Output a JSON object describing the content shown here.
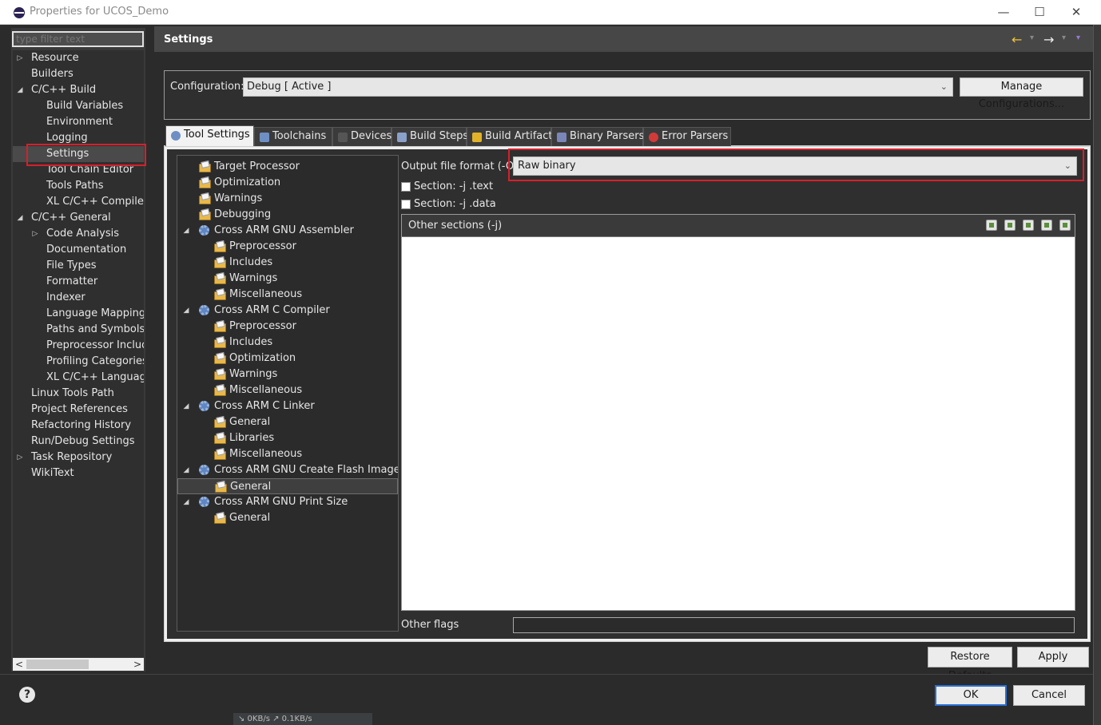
{
  "window": {
    "title": "Properties for UCOS_Demo",
    "controls": [
      "—",
      "☐",
      "✕"
    ]
  },
  "filter": {
    "placeholder": "type filter text"
  },
  "nav": {
    "items": [
      {
        "label": "Resource",
        "expander": "right"
      },
      {
        "label": "Builders"
      },
      {
        "label": "C/C++ Build",
        "expander": "down"
      },
      {
        "label": "Build Variables"
      },
      {
        "label": "Environment"
      },
      {
        "label": "Logging"
      },
      {
        "label": "Settings",
        "selected": true
      },
      {
        "label": "Tool Chain Editor"
      },
      {
        "label": "Tools Paths"
      },
      {
        "label": "XL C/C++ Compiler"
      },
      {
        "label": "C/C++ General",
        "expander": "down"
      },
      {
        "label": "Code Analysis",
        "expander": "right"
      },
      {
        "label": "Documentation"
      },
      {
        "label": "File Types"
      },
      {
        "label": "Formatter"
      },
      {
        "label": "Indexer"
      },
      {
        "label": "Language Mappings"
      },
      {
        "label": "Paths and Symbols"
      },
      {
        "label": "Preprocessor Include"
      },
      {
        "label": "Profiling Categories"
      },
      {
        "label": "XL C/C++ Language"
      },
      {
        "label": "Linux Tools Path"
      },
      {
        "label": "Project References"
      },
      {
        "label": "Refactoring History"
      },
      {
        "label": "Run/Debug Settings"
      },
      {
        "label": "Task Repository",
        "expander": "right"
      },
      {
        "label": "WikiText"
      }
    ],
    "scroll_left": "<",
    "scroll_right": ">"
  },
  "header": {
    "title": "Settings",
    "back_icon": "←",
    "forward_icon": "→",
    "menu_icon": "▾"
  },
  "config": {
    "label": "Configuration:",
    "value": "Debug  [ Active ]",
    "manage_label": "Manage Configurations..."
  },
  "tabs": [
    {
      "label": "Tool Settings",
      "icon": "gear-icon",
      "active": true
    },
    {
      "label": "Toolchains",
      "icon": "toolchain-icon"
    },
    {
      "label": "Devices",
      "icon": "chip-icon"
    },
    {
      "label": "Build Steps",
      "icon": "hammer-icon"
    },
    {
      "label": "Build Artifact",
      "icon": "trophy-icon"
    },
    {
      "label": "Binary Parsers",
      "icon": "binary-icon"
    },
    {
      "label": "Error Parsers",
      "icon": "error-icon"
    }
  ],
  "tooltree": {
    "items": [
      {
        "label": "Target Processor",
        "type": "folder"
      },
      {
        "label": "Optimization",
        "type": "folder"
      },
      {
        "label": "Warnings",
        "type": "folder"
      },
      {
        "label": "Debugging",
        "type": "folder"
      },
      {
        "label": "Cross ARM GNU Assembler",
        "type": "tool"
      },
      {
        "label": "Preprocessor",
        "type": "folder"
      },
      {
        "label": "Includes",
        "type": "folder"
      },
      {
        "label": "Warnings",
        "type": "folder"
      },
      {
        "label": "Miscellaneous",
        "type": "folder"
      },
      {
        "label": "Cross ARM C Compiler",
        "type": "tool"
      },
      {
        "label": "Preprocessor",
        "type": "folder"
      },
      {
        "label": "Includes",
        "type": "folder"
      },
      {
        "label": "Optimization",
        "type": "folder"
      },
      {
        "label": "Warnings",
        "type": "folder"
      },
      {
        "label": "Miscellaneous",
        "type": "folder"
      },
      {
        "label": "Cross ARM C Linker",
        "type": "tool"
      },
      {
        "label": "General",
        "type": "folder"
      },
      {
        "label": "Libraries",
        "type": "folder"
      },
      {
        "label": "Miscellaneous",
        "type": "folder"
      },
      {
        "label": "Cross ARM GNU Create Flash Image",
        "type": "tool"
      },
      {
        "label": "General",
        "type": "folder",
        "selected": true
      },
      {
        "label": "Cross ARM GNU Print Size",
        "type": "tool"
      },
      {
        "label": "General",
        "type": "folder"
      }
    ]
  },
  "options": {
    "format_label": "Output file format (-O)",
    "format_value": "Raw binary",
    "section_text": "Section: -j .text",
    "section_data": "Section: -j .data",
    "other_sections": "Other sections (-j)",
    "other_flags": "Other flags"
  },
  "buttons": {
    "restore": "Restore Defaults",
    "apply": "Apply",
    "ok": "OK",
    "cancel": "Cancel",
    "help": "?"
  },
  "taskbar": {
    "net": "↘ 0KB/s    ↗ 0.1KB/s"
  },
  "colors": {
    "highlight": "#d6202b",
    "ok_border": "#2a6fd6"
  }
}
